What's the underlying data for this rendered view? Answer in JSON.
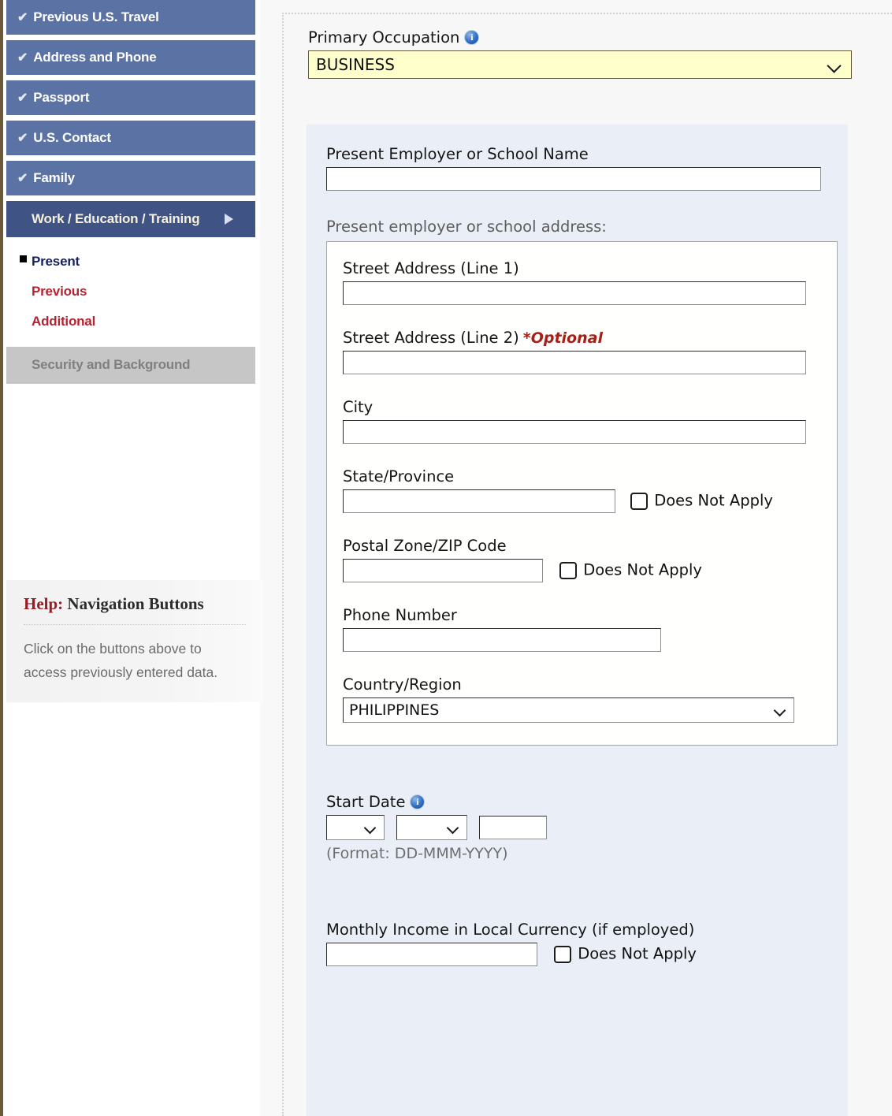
{
  "sidebar": {
    "nav_items": [
      {
        "label": "Previous U.S. Travel",
        "icon": "check-icon",
        "state": "complete"
      },
      {
        "label": "Address and Phone",
        "icon": "check-icon",
        "state": "complete"
      },
      {
        "label": "Passport",
        "icon": "check-icon",
        "state": "complete"
      },
      {
        "label": "U.S. Contact",
        "icon": "check-icon",
        "state": "complete"
      },
      {
        "label": "Family",
        "icon": "check-icon",
        "state": "complete"
      }
    ],
    "check_glyph": "✔",
    "active_section": {
      "label": "Work / Education / Training",
      "arrow_icon": "triangle-right-icon"
    },
    "sub_items": [
      {
        "label": "Present",
        "state": "current"
      },
      {
        "label": "Previous",
        "state": "link"
      },
      {
        "label": "Additional",
        "state": "link"
      }
    ],
    "disabled_section": {
      "label": "Security and Background"
    },
    "help": {
      "title_prefix": "Help:",
      "title_text": "Navigation Buttons",
      "body": "Click on the buttons above to access previously entered data."
    },
    "colors": {
      "nav_bg": "#5b72a4",
      "nav_active_bg": "#3f5384",
      "link_red": "#b62230",
      "disabled_bg": "#c6c6c6",
      "left_border": "#6b5a38"
    }
  },
  "main": {
    "occupation": {
      "label": "Primary Occupation",
      "info_icon": "info-icon",
      "value": "BUSINESS",
      "options": [
        "BUSINESS"
      ],
      "field_bg": "#ffffcc"
    },
    "employer_name": {
      "label": "Present Employer or School Name",
      "value": "",
      "placeholder": ""
    },
    "address": {
      "legend": "Present employer or school address:",
      "street1": {
        "label": "Street Address (Line 1)",
        "value": ""
      },
      "street2": {
        "label": "Street Address (Line 2)",
        "optional_note": "*Optional",
        "value": ""
      },
      "city": {
        "label": "City",
        "value": ""
      },
      "state": {
        "label": "State/Province",
        "value": "",
        "does_not_apply_label": "Does Not Apply",
        "does_not_apply_checked": false
      },
      "postal": {
        "label": "Postal Zone/ZIP Code",
        "value": "",
        "does_not_apply_label": "Does Not Apply",
        "does_not_apply_checked": false
      },
      "phone": {
        "label": "Phone Number",
        "value": ""
      },
      "country": {
        "label": "Country/Region",
        "value": "PHILIPPINES",
        "options": [
          "PHILIPPINES"
        ]
      }
    },
    "start_date": {
      "label": "Start Date",
      "info_icon": "info-icon",
      "day": "",
      "month": "",
      "year": "",
      "format_note": "(Format: DD-MMM-YYYY)"
    },
    "income": {
      "label": "Monthly Income in Local Currency (if employed)",
      "value": "",
      "does_not_apply_label": "Does Not Apply",
      "does_not_apply_checked": false
    }
  }
}
